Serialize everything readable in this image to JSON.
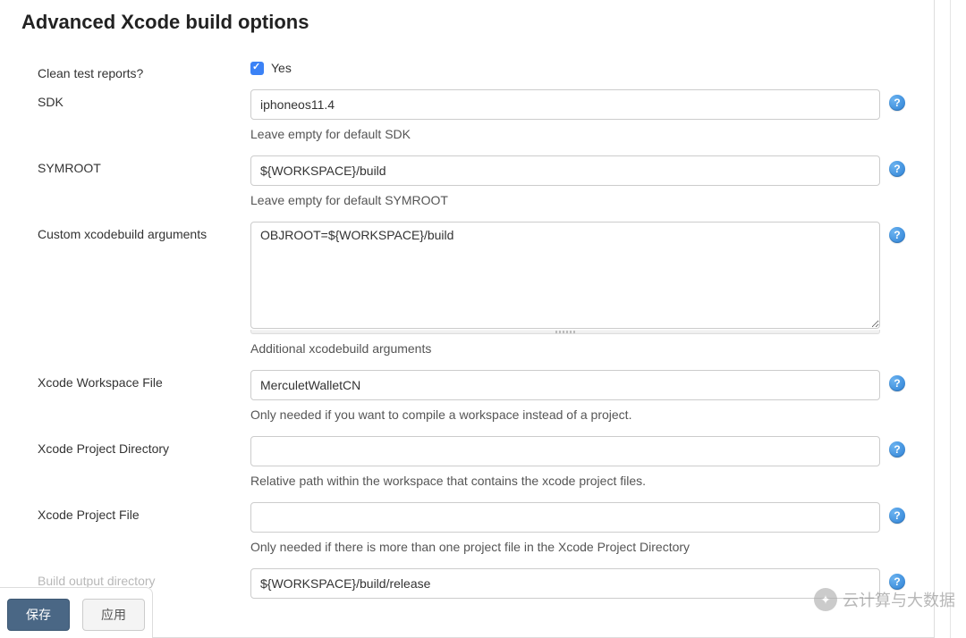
{
  "section": {
    "title": "Advanced Xcode build options"
  },
  "fields": {
    "cleanReports": {
      "label": "Clean test reports?",
      "checkboxLabel": "Yes",
      "checked": true
    },
    "sdk": {
      "label": "SDK",
      "value": "iphoneos11.4",
      "help": "Leave empty for default SDK"
    },
    "symroot": {
      "label": "SYMROOT",
      "value": "${WORKSPACE}/build",
      "help": "Leave empty for default SYMROOT"
    },
    "customArgs": {
      "label": "Custom xcodebuild arguments",
      "value": "OBJROOT=${WORKSPACE}/build",
      "help": "Additional xcodebuild arguments"
    },
    "workspaceFile": {
      "label": "Xcode Workspace File",
      "value": "MerculetWalletCN",
      "help": "Only needed if you want to compile a workspace instead of a project."
    },
    "projectDir": {
      "label": "Xcode Project Directory",
      "value": "",
      "help": "Relative path within the workspace that contains the xcode project files."
    },
    "projectFile": {
      "label": "Xcode Project File",
      "value": "",
      "help": "Only needed if there is more than one project file in the Xcode Project Directory"
    },
    "buildOutput": {
      "label": "Build output directory",
      "value": "${WORKSPACE}/build/release"
    }
  },
  "buttons": {
    "save": "保存",
    "apply": "应用"
  },
  "watermark": {
    "text": "云计算与大数据"
  },
  "helpIconGlyph": "?"
}
